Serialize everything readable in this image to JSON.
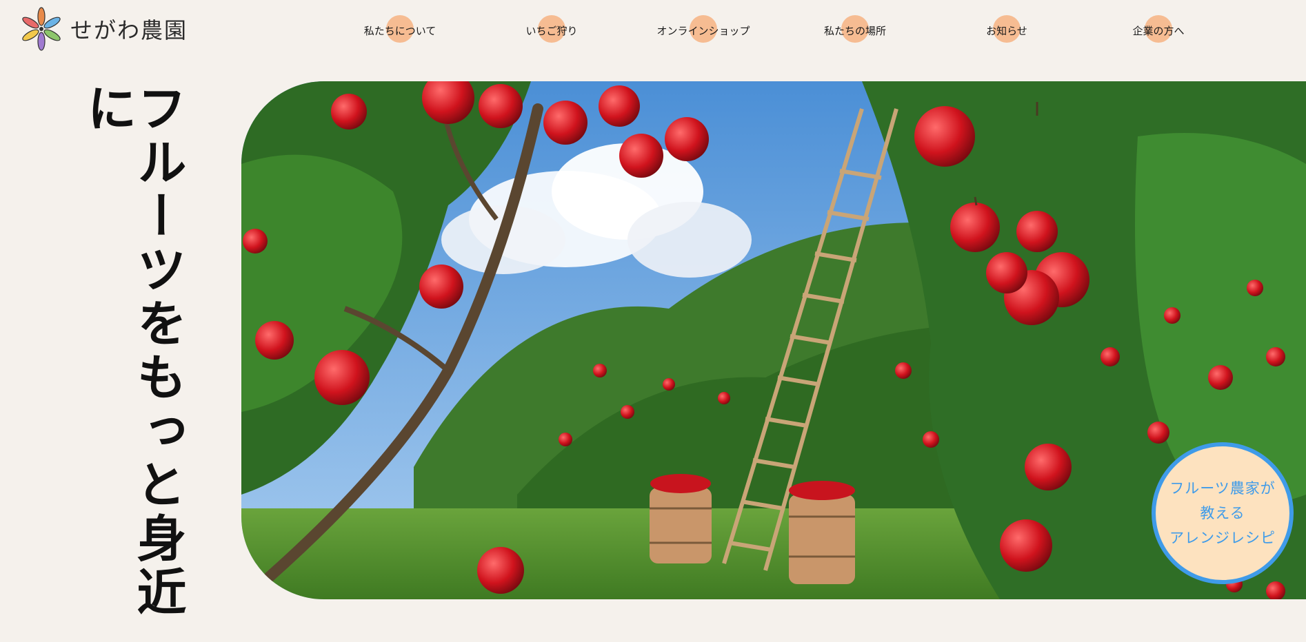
{
  "brand": {
    "name": "せがわ農園"
  },
  "nav": {
    "items": [
      {
        "label": "私たちについて"
      },
      {
        "label": "いちご狩り"
      },
      {
        "label": "オンラインショップ"
      },
      {
        "label": "私たちの場所"
      },
      {
        "label": "お知らせ"
      },
      {
        "label": "企業の方へ"
      }
    ]
  },
  "hero": {
    "catchphrase": "フルーツをもっと身近に",
    "image_subject": "apple-orchard-photo"
  },
  "badge": {
    "line1": "フルーツ農家が",
    "line2": "教える",
    "line3": "アレンジレシピ"
  },
  "colors": {
    "background": "#f5f1ec",
    "nav_dot": "#f6bc92",
    "badge_fill": "#fde2bf",
    "badge_accent": "#3f9be9"
  }
}
